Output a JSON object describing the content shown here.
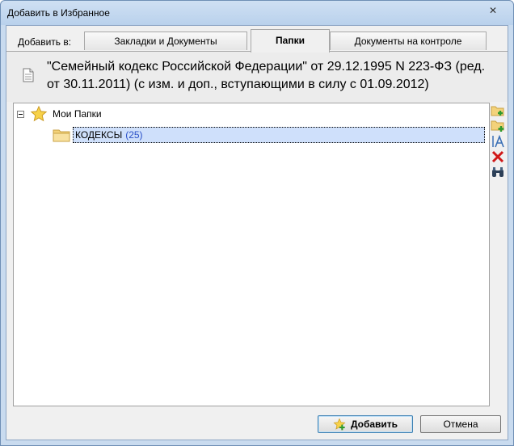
{
  "window": {
    "title": "Добавить в Избранное",
    "close_glyph": "✕"
  },
  "tabs": {
    "label": "Добавить в:",
    "items": [
      {
        "label": "Закладки и Документы"
      },
      {
        "label": "Папки"
      },
      {
        "label": "Документы на контроле"
      }
    ],
    "active_index": 1
  },
  "document": {
    "title": "\"Семейный кодекс Российской Федерации\" от 29.12.1995 N 223-ФЗ (ред. от 30.11.2011) (с изм. и доп., вступающими в силу с 01.09.2012)",
    "icon": "document-icon"
  },
  "tree": {
    "root": {
      "label": "Мои Папки",
      "icon": "star-icon",
      "expanded": true
    },
    "children": [
      {
        "label": "КОДЕКСЫ",
        "count": "(25)",
        "icon": "folder-icon",
        "selected": true
      }
    ]
  },
  "toolbar": {
    "tools": [
      "new-folder-icon",
      "new-subfolder-icon",
      "rename-icon",
      "delete-icon",
      "find-icon"
    ]
  },
  "buttons": {
    "add_label": "Добавить",
    "cancel_label": "Отмена"
  },
  "colors": {
    "accent": "#cfe0fb",
    "count": "#2a50c8",
    "delete": "#d01818"
  }
}
